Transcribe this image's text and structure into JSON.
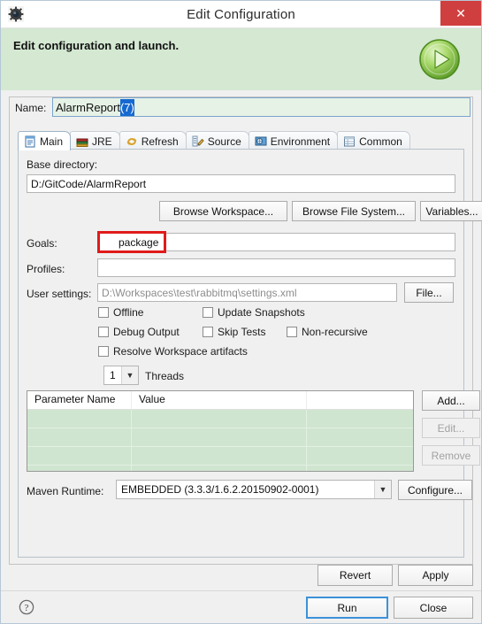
{
  "window": {
    "title": "Edit Configuration",
    "app_icon": "gear-icon",
    "close_label": "✕"
  },
  "banner": {
    "message": "Edit configuration and launch.",
    "icon": "run-play-icon"
  },
  "name_field": {
    "label": "Name:",
    "value_base": "AlarmReport",
    "value_selected": "(7)",
    "full_value": "AlarmReport (7)"
  },
  "tabs": [
    {
      "label": "Main",
      "icon": "main-document-icon",
      "active": true
    },
    {
      "label": "JRE",
      "icon": "jre-books-icon",
      "active": false
    },
    {
      "label": "Refresh",
      "icon": "refresh-arrows-icon",
      "active": false
    },
    {
      "label": "Source",
      "icon": "source-pencil-icon",
      "active": false
    },
    {
      "label": "Environment",
      "icon": "environment-icon",
      "active": false
    },
    {
      "label": "Common",
      "icon": "common-table-icon",
      "active": false
    }
  ],
  "main_tab": {
    "base_directory": {
      "label": "Base directory:",
      "value": "D:/GitCode/AlarmReport"
    },
    "dir_buttons": [
      {
        "label": "Browse Workspace..."
      },
      {
        "label": "Browse File System..."
      },
      {
        "label": "Variables..."
      }
    ],
    "goals": {
      "label": "Goals:",
      "value": "package",
      "highlight_color": "#e01b1b"
    },
    "profiles": {
      "label": "Profiles:",
      "value": ""
    },
    "user_settings": {
      "label": "User settings:",
      "value": "D:\\Workspaces\\test\\rabbitmq\\settings.xml",
      "is_placeholder": true,
      "button_label": "File..."
    },
    "checkboxes": [
      {
        "label": "Offline",
        "checked": false
      },
      {
        "label": "Update Snapshots",
        "checked": false
      },
      {
        "label": "Debug Output",
        "checked": false
      },
      {
        "label": "Skip Tests",
        "checked": false
      },
      {
        "label": "Non-recursive",
        "checked": false
      },
      {
        "label": "Resolve Workspace artifacts",
        "checked": false
      }
    ],
    "threads": {
      "value": "1",
      "label": "Threads"
    },
    "parameter_table": {
      "columns": [
        "Parameter Name",
        "Value",
        ""
      ],
      "rows": [],
      "empty_row_count": 4,
      "buttons": [
        {
          "label": "Add...",
          "enabled": true
        },
        {
          "label": "Edit...",
          "enabled": false
        },
        {
          "label": "Remove",
          "enabled": false
        }
      ]
    },
    "maven_runtime": {
      "label": "Maven Runtime:",
      "value": "EMBEDDED (3.3.3/1.6.2.20150902-0001)",
      "button_label": "Configure..."
    }
  },
  "action_bar": {
    "revert_label": "Revert",
    "apply_label": "Apply"
  },
  "footer": {
    "help_icon": "help-question-icon",
    "run_label": "Run",
    "close_label": "Close"
  },
  "colors": {
    "banner_bg": "#d4e8d2",
    "close_btn": "#cf3f3f",
    "selection_blue": "#1669d1",
    "annotation_red": "#e01b1b",
    "table_row_green": "#cfe5cf",
    "default_btn_border": "#3c91d8"
  }
}
